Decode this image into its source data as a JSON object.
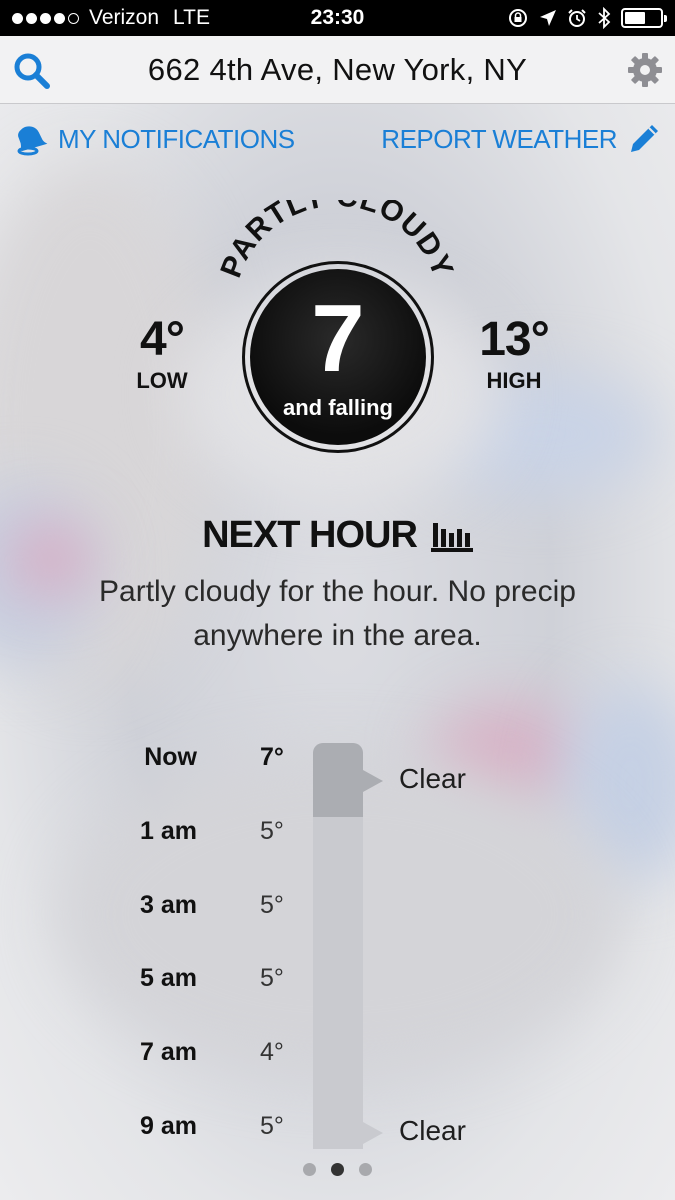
{
  "status_bar": {
    "carrier": "Verizon",
    "network": "LTE",
    "time": "23:30",
    "signal_bars_filled": 4,
    "signal_bars_total": 5,
    "battery_level": 0.6
  },
  "header": {
    "location": "662 4th Ave, New York, NY",
    "search_icon": "search-icon",
    "settings_icon": "gear-icon"
  },
  "actions": {
    "notifications_label": "MY NOTIFICATIONS",
    "report_label": "REPORT WEATHER"
  },
  "current": {
    "condition": "PARTLY CLOUDY",
    "temp": "7",
    "trend": "and falling",
    "low_value": "4°",
    "low_label": "LOW",
    "high_value": "13°",
    "high_label": "HIGH"
  },
  "next_hour": {
    "title": "NEXT HOUR",
    "summary": "Partly cloudy for the hour. No precip anywhere in the area."
  },
  "timeline": {
    "rows": [
      {
        "time": "Now",
        "temp": "7°"
      },
      {
        "time": "1 am",
        "temp": "5°"
      },
      {
        "time": "3 am",
        "temp": "5°"
      },
      {
        "time": "5 am",
        "temp": "5°"
      },
      {
        "time": "7 am",
        "temp": "4°"
      },
      {
        "time": "9 am",
        "temp": "5°"
      }
    ],
    "conditions": [
      {
        "label": "Clear"
      },
      {
        "label": "Clear"
      }
    ]
  },
  "pagination": {
    "total": 3,
    "active_index": 1
  },
  "colors": {
    "accent": "#1a7fd6",
    "text_dark": "#111111"
  }
}
